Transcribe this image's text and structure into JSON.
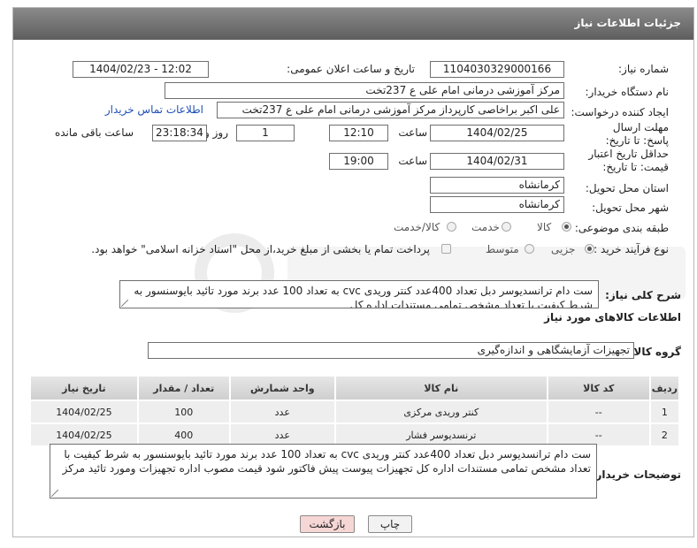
{
  "header": {
    "title": "جزئیات اطلاعات نیاز"
  },
  "fields": {
    "need_number_label": "شماره نیاز:",
    "need_number": "1104030329000166",
    "announce_label": "تاریخ و ساعت اعلان عمومی:",
    "announce_value": "1404/02/23 - 12:02",
    "buyer_org_label": "نام دستگاه خریدار:",
    "buyer_org": "مرکز آموزشی درمانی امام علی ع 237تخت",
    "creator_label": "ایجاد کننده درخواست:",
    "creator": "علی اکبر براخاصی کارپرداز  مرکز آموزشی درمانی امام علی ع 237تخت",
    "contact_link": "اطلاعات تماس خریدار",
    "deadline_label": "مهلت ارسال پاسخ: تا تاریخ:",
    "deadline_date": "1404/02/25",
    "time_label": "ساعت",
    "deadline_time": "12:10",
    "days_value": "1",
    "days_label": "روز و",
    "remaining_time": "23:18:34",
    "remaining_label": "ساعت باقی مانده",
    "price_valid_label": "حداقل تاریخ اعتبار قیمت: تا تاریخ:",
    "price_valid_date": "1404/02/31",
    "price_valid_time": "19:00",
    "province_label": "استان محل تحویل:",
    "province": "کرمانشاه",
    "city_label": "شهر محل تحویل:",
    "city": "کرمانشاه",
    "category_label": "طبقه بندی موضوعی:",
    "category_options": [
      "کالا",
      "خدمت",
      "کالا/خدمت"
    ],
    "process_label": "نوع فرآیند خرید :",
    "process_options": [
      "جزیی",
      "متوسط"
    ],
    "payment_note": "پرداخت تمام یا بخشی از مبلغ خرید،از محل \"اسناد خزانه اسلامی\" خواهد بود."
  },
  "description": {
    "label": "شرح کلی نیاز:",
    "text": "ست دام ترانسدیوسر  دبل تعداد 400عدد کنتر وریدی cvc  به تعداد 100 عدد برند مورد تائید بایوسنسور به شرط کیفیت با تعداد مشخص تمامی مستندات اداره کل"
  },
  "goods": {
    "section_title": "اطلاعات کالاهای مورد نیاز",
    "group_label": "گروه کالا:",
    "group_value": "تجهیزات آزمایشگاهی و اندازه‌گیری",
    "columns": [
      "ردیف",
      "کد کالا",
      "نام کالا",
      "واحد شمارش",
      "تعداد / مقدار",
      "تاریخ نیاز"
    ],
    "rows": [
      [
        "1",
        "--",
        "کنتر وریدی مرکزی",
        "عدد",
        "100",
        "1404/02/25"
      ],
      [
        "2",
        "--",
        "ترنسدیوسر فشار",
        "عدد",
        "400",
        "1404/02/25"
      ]
    ]
  },
  "buyer_notes": {
    "label": "توضیحات خریدار:",
    "text": "ست دام ترانسدیوسر  دبل تعداد 400عدد کنتر وریدی cvc  به تعداد 100 عدد برند مورد تائید بایوسنسور به شرط کیفیت با تعداد مشخص تمامی مستندات اداره کل تجهیزات پیوست پیش فاکتور شود قیمت مصوب اداره تجهیزات ومورد تائید مرکز"
  },
  "buttons": {
    "back": "بازگشت",
    "print": "چاپ"
  },
  "colors": {
    "header_bg": "#6e6e6e",
    "link": "#1f4fb4",
    "back_btn": "#f7d6d6"
  }
}
